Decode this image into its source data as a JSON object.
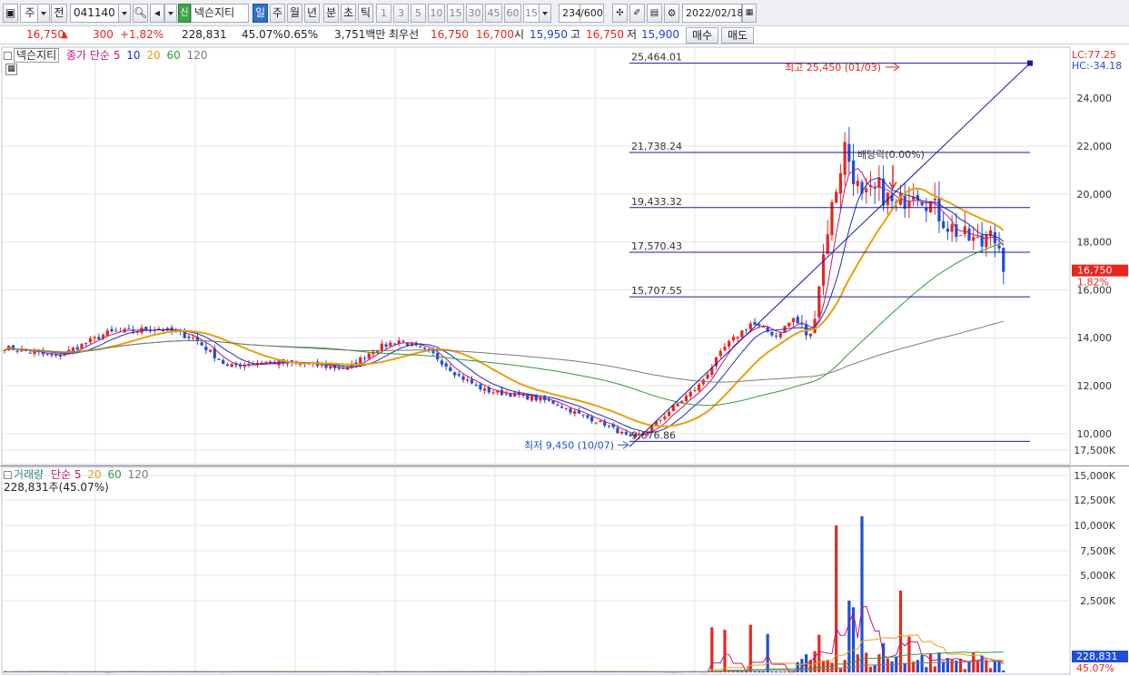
{
  "toolbar": {
    "market": "주",
    "prev": "전",
    "code": "041140",
    "badge": "신",
    "name": "넥슨지티",
    "periods": [
      "일",
      "주",
      "월",
      "년",
      "분",
      "초",
      "틱"
    ],
    "intervals": [
      "1",
      "3",
      "5",
      "10",
      "15",
      "30",
      "45",
      "60"
    ],
    "interval_value": "15",
    "count_value": "234",
    "count_total": "/600",
    "date": "2022/02/18"
  },
  "quote": {
    "price": "16,750",
    "change": "300",
    "change_pct": "+1.82%",
    "volume": "228,831",
    "volume_ratio": "45.07%",
    "turnover": "0.65%",
    "amount": "3,751백만",
    "best_label": "최우선",
    "ask": "16,750",
    "bid": "16,700",
    "open_label": "시",
    "open": "15,950",
    "high_label": "고",
    "high": "16,750",
    "low_label": "저",
    "low": "15,900",
    "buy_label": "매수",
    "sell_label": "매도"
  },
  "price_pane": {
    "title": "넥슨지티",
    "indicator": "종가 단순",
    "ma_periods": [
      "5",
      "10",
      "20",
      "60",
      "120"
    ],
    "lc": "LC:77.25",
    "hc": "HC:-34.18",
    "y_ticks": [
      "24,000",
      "22,000",
      "20,000",
      "18,000",
      "16,000",
      "14,000",
      "12,000",
      "10,000"
    ],
    "current_price": "16,750",
    "current_pct": "1.82%",
    "fib_levels": [
      "25,464.01",
      "21,738.24",
      "19,433.32",
      "17,570.43",
      "15,707.55",
      "9,676.86"
    ],
    "high_note": "최고 25,450 (01/03)",
    "low_note": "최저 9,450 (10/07)",
    "dividend_note": "배당락(0.00%)"
  },
  "volume_pane": {
    "title": "거래량",
    "indicator": "단순",
    "ma_periods": [
      "5",
      "20",
      "60",
      "120"
    ],
    "current_volume": "228,831주(45.07%)",
    "y_ticks": [
      "17,500K",
      "15,000K",
      "12,500K",
      "10,000K",
      "7,500K",
      "5,000K",
      "2,500K"
    ],
    "current_badge": "228,831",
    "current_badge_pct": "45.07%"
  },
  "colors": {
    "up": "#e8261e",
    "down": "#1d4fd6",
    "ma5": "#c2187a",
    "ma10": "#1a2fb8",
    "ma20": "#e8a010",
    "ma60": "#2e9b3c",
    "ma120": "#7a7a7a",
    "fib_line": "#1a1aa8"
  }
}
